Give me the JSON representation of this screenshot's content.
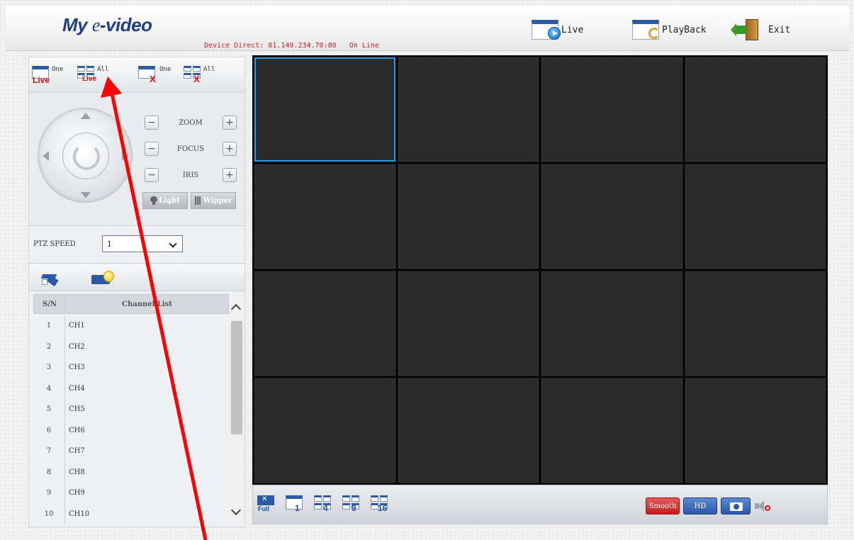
{
  "header": {
    "logo_my": "My ",
    "logo_e": "e",
    "logo_rest": "-video",
    "device_info": "Device Direct: 81.149.234.70:80   On Line",
    "live_label": "Live",
    "playback_label": "PlayBack",
    "exit_label": "Exit"
  },
  "toolbar": {
    "one_live": {
      "label": "One",
      "sub": "Live"
    },
    "all_live": {
      "label": "All",
      "sub": "Live"
    },
    "one_close": {
      "label": "One",
      "sub": "X"
    },
    "all_close": {
      "label": "All",
      "sub": "X"
    }
  },
  "ptz": {
    "zoom_label": "ZOOM",
    "focus_label": "FOCUS",
    "iris_label": "IRIS",
    "minus": "−",
    "plus": "+",
    "light_label": "Light",
    "wiper_label": "Wipper",
    "speed_label": "PTZ SPEED",
    "speed_value": "1"
  },
  "channel_list": {
    "col_sn": "S/N",
    "col_name": "Channel List",
    "rows": [
      {
        "sn": "1",
        "name": "CH1"
      },
      {
        "sn": "2",
        "name": "CH2"
      },
      {
        "sn": "3",
        "name": "CH3"
      },
      {
        "sn": "4",
        "name": "CH4"
      },
      {
        "sn": "5",
        "name": "CH5"
      },
      {
        "sn": "6",
        "name": "CH6"
      },
      {
        "sn": "7",
        "name": "CH7"
      },
      {
        "sn": "8",
        "name": "CH8"
      },
      {
        "sn": "9",
        "name": "CH9"
      },
      {
        "sn": "10",
        "name": "CH10"
      }
    ]
  },
  "video": {
    "cell_count": 16,
    "selected_cell": 1
  },
  "bottom": {
    "full_label": "Full",
    "layout_1": "1",
    "layout_4": "4",
    "layout_9": "9",
    "layout_16": "16",
    "smooth_label": "Smooth",
    "hd_label": "HD"
  },
  "colors": {
    "accent_blue": "#2a5aa6",
    "status_red": "#d62020",
    "selection": "#2b9be6",
    "annotation_arrow": "#ff0000"
  }
}
